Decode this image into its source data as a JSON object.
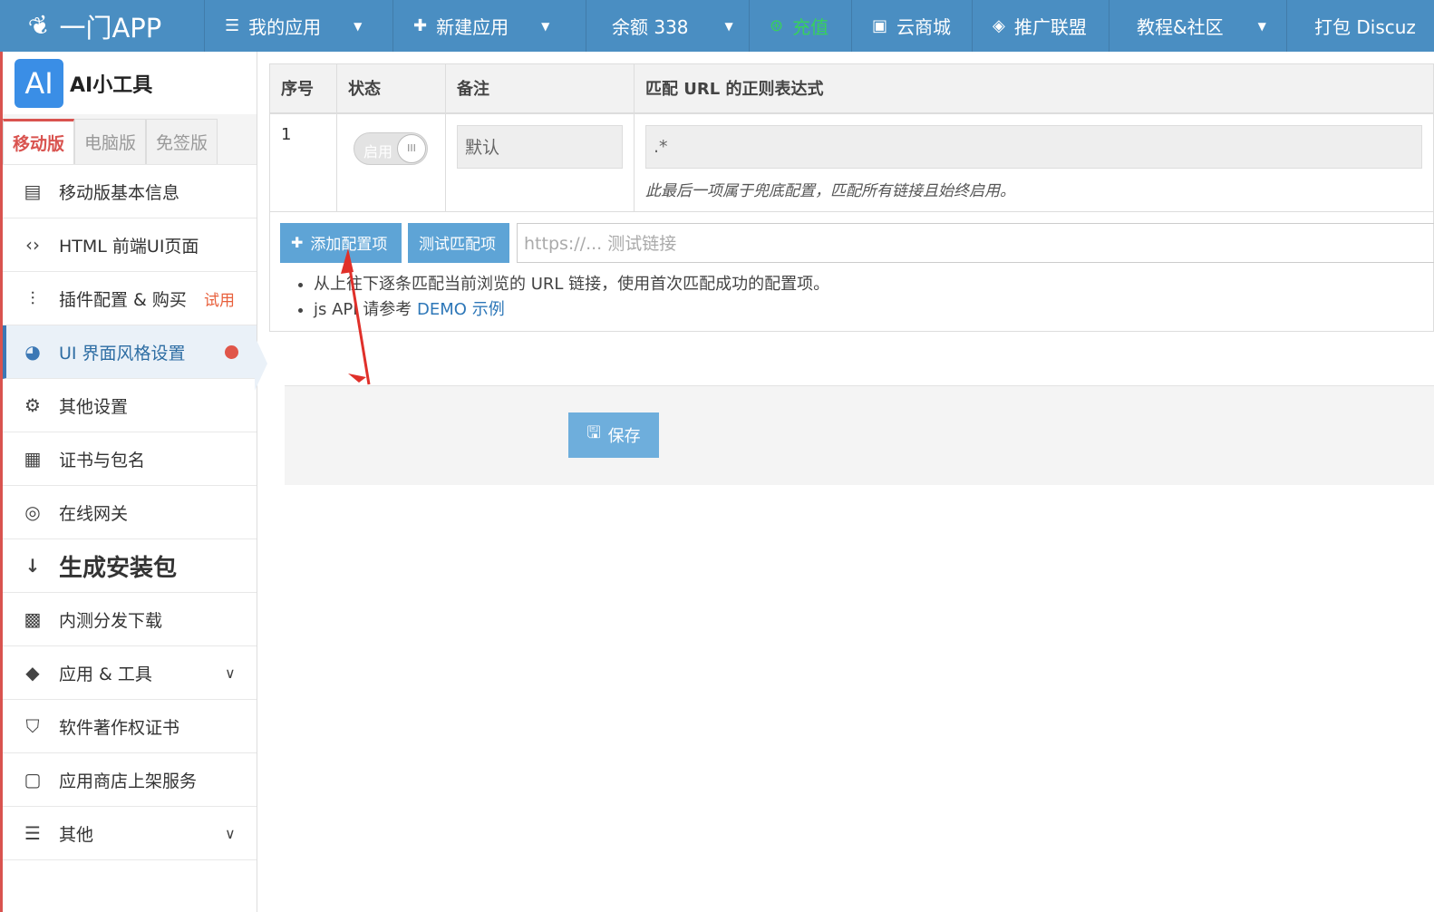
{
  "topnav": {
    "brand": "一门APP",
    "items": [
      {
        "icon": "menu-icon",
        "label": "我的应用",
        "has_caret": true
      },
      {
        "icon": "plus-icon",
        "label": "新建应用",
        "has_caret": true
      },
      {
        "icon": "",
        "label": "余额 338",
        "has_caret": true
      },
      {
        "icon": "recharge-icon",
        "label": "充值",
        "has_caret": false
      },
      {
        "icon": "store-icon",
        "label": "云商城",
        "has_caret": false
      },
      {
        "icon": "diamond-icon",
        "label": "推广联盟",
        "has_caret": false
      },
      {
        "icon": "",
        "label": "教程&社区",
        "has_caret": true
      },
      {
        "icon": "",
        "label": "打包 Discuz",
        "has_caret": false
      }
    ]
  },
  "sidebar": {
    "app_logo": "AI",
    "app_name": "AI小工具",
    "version_tabs": [
      "移动版",
      "电脑版",
      "免签版"
    ],
    "active_tab": 0,
    "items": [
      {
        "label": "移动版基本信息",
        "icon": "document-icon"
      },
      {
        "label": "HTML 前端UI页面",
        "icon": "code-icon"
      },
      {
        "label": "插件配置 & 购买",
        "icon": "sliders-icon",
        "badge": "试用"
      },
      {
        "label": "UI 界面风格设置",
        "icon": "palette-icon",
        "active": true
      },
      {
        "label": "其他设置",
        "icon": "gear-icon"
      },
      {
        "label": "证书与包名",
        "icon": "certificate-icon"
      },
      {
        "label": "在线网关",
        "icon": "globe-icon"
      },
      {
        "label": "生成安装包",
        "icon": "sort-download-icon"
      },
      {
        "label": "内测分发下载",
        "icon": "qrcode-icon"
      },
      {
        "label": "应用 & 工具",
        "icon": "apps-icon"
      },
      {
        "label": "软件著作权证书",
        "icon": "shield-icon"
      },
      {
        "label": "应用商店上架服务",
        "icon": "store-badge-icon"
      },
      {
        "label": "其他",
        "icon": "bars-icon"
      }
    ]
  },
  "table": {
    "headers": [
      "序号",
      "状态",
      "备注",
      "匹配 URL 的正则表达式"
    ],
    "rows": [
      {
        "index": "1",
        "status_label": "启用",
        "remark": "默认",
        "regex": ".*",
        "note": "此最后一项属于兜底配置，匹配所有链接且始终启用。"
      }
    ]
  },
  "actions": {
    "add_label": "添加配置项",
    "test_label": "测试匹配项",
    "test_placeholder": "https://... 测试链接",
    "tip1": "从上往下逐条匹配当前浏览的 URL 链接，使用首次匹配成功的配置项。",
    "tip2_prefix": "js API 请参考",
    "tip2_link": "DEMO 示例"
  },
  "footer": {
    "save_label": "保存"
  },
  "colors": {
    "nav_bg": "#4a8ec2",
    "accent_red": "#d9534f",
    "button_blue": "#5ea4d6",
    "recharge_green": "#37d15c"
  }
}
